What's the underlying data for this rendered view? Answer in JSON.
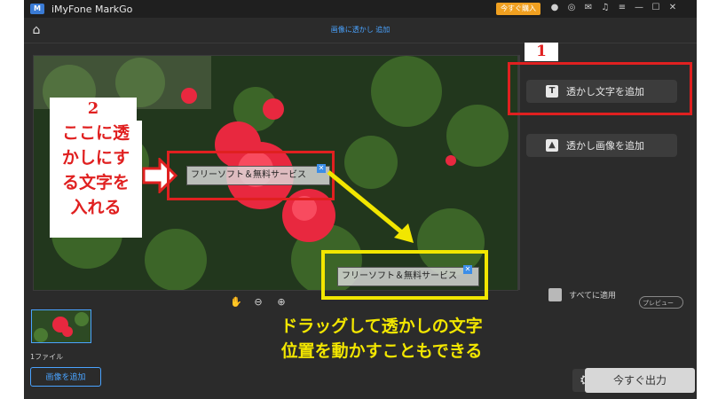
{
  "app": {
    "title": "iMyFone MarkGo",
    "logo_text": "M",
    "buy_button": "今すぐ購入",
    "accent_color": "#4aa3ff"
  },
  "titlebar_icons": [
    "user-icon",
    "discord-icon",
    "mail-icon",
    "headset-icon",
    "menu-icon",
    "minimize-icon",
    "maximize-icon",
    "close-icon"
  ],
  "header": {
    "page_title": "画像に透かし 追加"
  },
  "canvas": {
    "watermark_text_1": "フリーソフト＆無料サービス",
    "watermark_text_2": "フリーソフト＆無料サービス"
  },
  "tools": [
    "hand-icon",
    "zoom-out-icon",
    "zoom-in-icon"
  ],
  "right_panel": {
    "add_text_button": "透かし文字を追加",
    "add_text_icon": "T",
    "add_image_button": "透かし画像を追加",
    "apply_all_label": "すべてに適用",
    "preview_label": "プレビュー"
  },
  "bottom": {
    "file_count": "1ファイル",
    "add_image_button": "画像を追加",
    "export_button": "今すぐ出力"
  },
  "annotations": {
    "label_1": "1",
    "label_2": "2",
    "note_lines": [
      "ここに透",
      "かしにす",
      "る文字を",
      "入れる"
    ],
    "yellow_lines": [
      "ドラッグして透かしの文字",
      "位置を動かすこともできる"
    ],
    "red_color": "#e02020",
    "yellow_color": "#f2e600"
  }
}
